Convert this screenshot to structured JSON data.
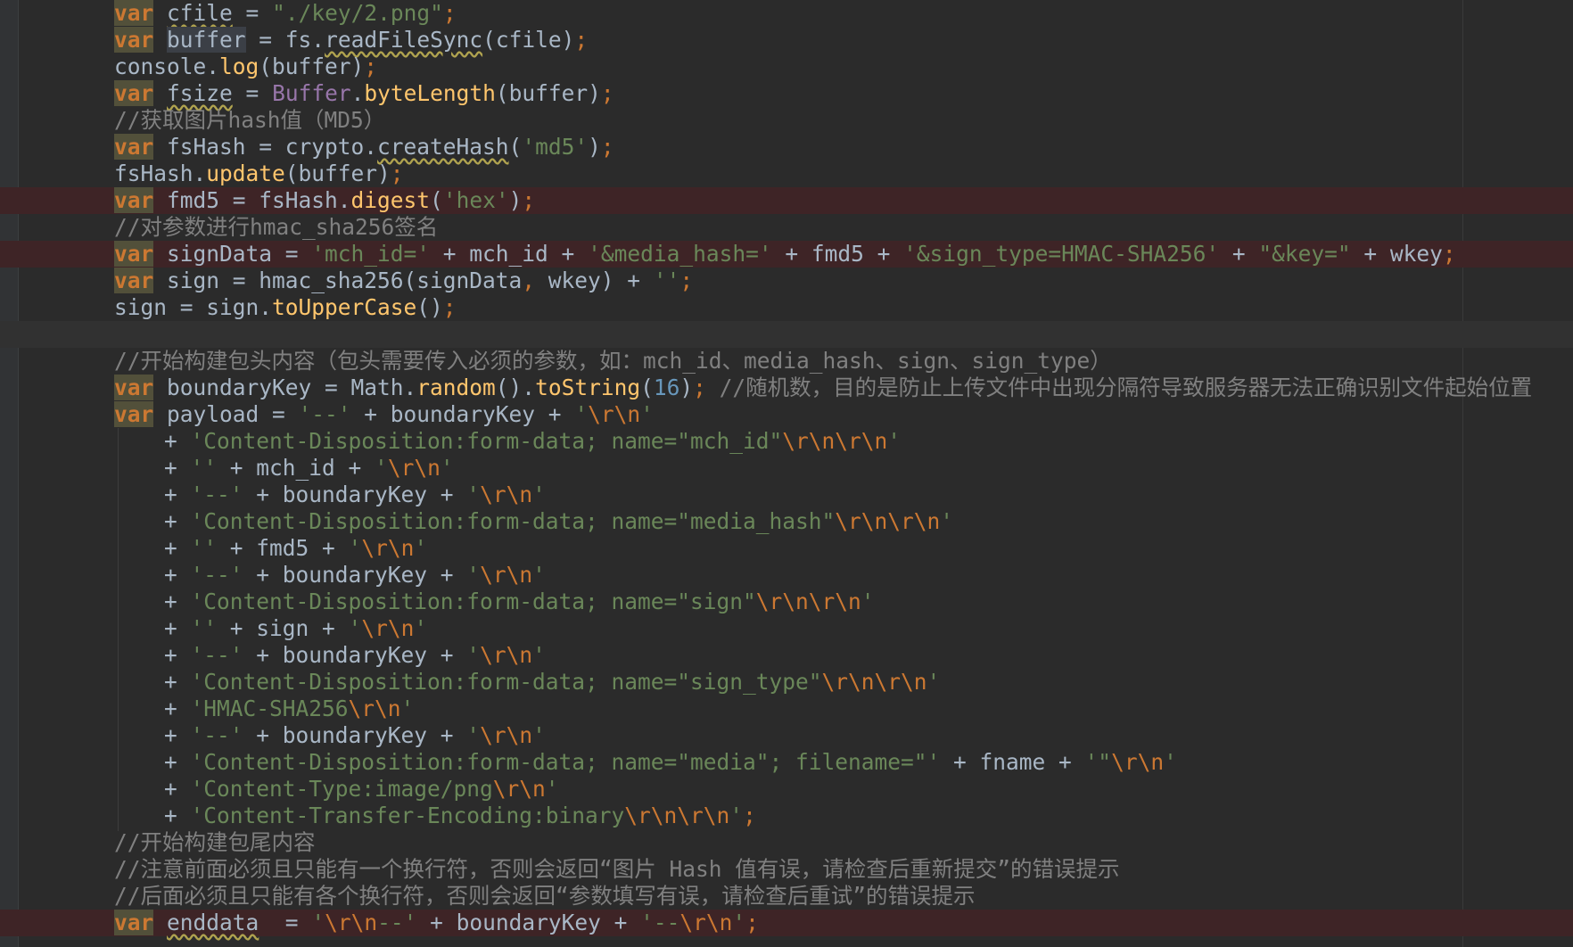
{
  "editor": {
    "lines": [
      {
        "type": "normal",
        "tokens": [
          [
            "kw",
            "var"
          ],
          [
            "t",
            " "
          ],
          [
            "sq",
            "cfile"
          ],
          [
            "t",
            " = "
          ],
          [
            "str",
            "\"./key/2.png\""
          ],
          [
            "pun",
            ";"
          ]
        ]
      },
      {
        "type": "normal",
        "tokens": [
          [
            "kw",
            "var"
          ],
          [
            "t",
            " "
          ],
          [
            "hl",
            "buffer"
          ],
          [
            "t",
            " = fs."
          ],
          [
            "sq",
            "readFileSync"
          ],
          [
            "t",
            "(cfile)"
          ],
          [
            "pun",
            ";"
          ]
        ]
      },
      {
        "type": "normal",
        "tokens": [
          [
            "t",
            "console."
          ],
          [
            "fn",
            "log"
          ],
          [
            "t",
            "(buffer)"
          ],
          [
            "pun",
            ";"
          ]
        ]
      },
      {
        "type": "normal",
        "tokens": [
          [
            "kw",
            "var"
          ],
          [
            "t",
            " "
          ],
          [
            "sq",
            "fsize"
          ],
          [
            "t",
            " = "
          ],
          [
            "cls",
            "Buffer"
          ],
          [
            "t",
            "."
          ],
          [
            "fn",
            "byteLength"
          ],
          [
            "t",
            "(buffer)"
          ],
          [
            "pun",
            ";"
          ]
        ]
      },
      {
        "type": "normal",
        "tokens": [
          [
            "cmt",
            "//获取图片hash值（MD5）"
          ]
        ]
      },
      {
        "type": "normal",
        "tokens": [
          [
            "kw",
            "var"
          ],
          [
            "t",
            " fsHash = crypto."
          ],
          [
            "sq",
            "createHash"
          ],
          [
            "t",
            "("
          ],
          [
            "str",
            "'md5'"
          ],
          [
            "t",
            ")"
          ],
          [
            "pun",
            ";"
          ]
        ]
      },
      {
        "type": "normal",
        "tokens": [
          [
            "t",
            "fsHash."
          ],
          [
            "fn",
            "update"
          ],
          [
            "t",
            "(buffer)"
          ],
          [
            "pun",
            ";"
          ]
        ]
      },
      {
        "type": "error",
        "tokens": [
          [
            "kw",
            "var"
          ],
          [
            "t",
            " fmd5 = fsHash."
          ],
          [
            "fn",
            "digest"
          ],
          [
            "t",
            "("
          ],
          [
            "str",
            "'hex'"
          ],
          [
            "t",
            ")"
          ],
          [
            "pun",
            ";"
          ]
        ]
      },
      {
        "type": "normal",
        "tokens": [
          [
            "cmt",
            "//对参数进行hmac_sha256签名"
          ]
        ]
      },
      {
        "type": "error",
        "tokens": [
          [
            "kw",
            "var"
          ],
          [
            "t",
            " signData = "
          ],
          [
            "str",
            "'mch_id='"
          ],
          [
            "t",
            " + mch_id + "
          ],
          [
            "str",
            "'&media_hash='"
          ],
          [
            "t",
            " + fmd5 + "
          ],
          [
            "str",
            "'&sign_type=HMAC-SHA256'"
          ],
          [
            "t",
            " + "
          ],
          [
            "str",
            "\"&key=\""
          ],
          [
            "t",
            " + wkey"
          ],
          [
            "pun",
            ";"
          ]
        ]
      },
      {
        "type": "normal",
        "tokens": [
          [
            "kw",
            "var"
          ],
          [
            "t",
            " sign = hmac_sha256(signData"
          ],
          [
            "pun",
            ","
          ],
          [
            "t",
            " wkey) + "
          ],
          [
            "str",
            "''"
          ],
          [
            "pun",
            ";"
          ]
        ]
      },
      {
        "type": "normal",
        "tokens": [
          [
            "t",
            "sign = sign."
          ],
          [
            "fn",
            "toUpperCase"
          ],
          [
            "t",
            "()"
          ],
          [
            "pun",
            ";"
          ]
        ]
      },
      {
        "type": "caret",
        "tokens": []
      },
      {
        "type": "normal",
        "tokens": [
          [
            "cmt",
            "//开始构建包头内容（包头需要传入必须的参数，如：mch_id、media_hash、sign、sign_type）"
          ]
        ]
      },
      {
        "type": "normal",
        "tokens": [
          [
            "kw",
            "var"
          ],
          [
            "t",
            " boundaryKey = Math."
          ],
          [
            "fn",
            "random"
          ],
          [
            "t",
            "()."
          ],
          [
            "fn",
            "toString"
          ],
          [
            "t",
            "("
          ],
          [
            "num",
            "16"
          ],
          [
            "t",
            ")"
          ],
          [
            "pun",
            ";"
          ],
          [
            "t",
            " "
          ],
          [
            "cmt",
            "//随机数，目的是防止上传文件中出现分隔符导致服务器无法正确识别文件起始位置"
          ]
        ]
      },
      {
        "type": "normal",
        "tokens": [
          [
            "kw",
            "var"
          ],
          [
            "t",
            " payload = "
          ],
          [
            "str",
            "'--'"
          ],
          [
            "t",
            " + boundaryKey + "
          ],
          [
            "str",
            "'"
          ],
          [
            "esc",
            "\\r\\n"
          ],
          [
            "str",
            "'"
          ]
        ]
      },
      {
        "type": "cont",
        "tokens": [
          [
            "t",
            "+ "
          ],
          [
            "str",
            "'Content-Disposition:form-data; name=\"mch_id\""
          ],
          [
            "esc",
            "\\r\\n\\r\\n"
          ],
          [
            "str",
            "'"
          ]
        ]
      },
      {
        "type": "cont",
        "tokens": [
          [
            "t",
            "+ "
          ],
          [
            "str",
            "''"
          ],
          [
            "t",
            " + mch_id + "
          ],
          [
            "str",
            "'"
          ],
          [
            "esc",
            "\\r\\n"
          ],
          [
            "str",
            "'"
          ]
        ]
      },
      {
        "type": "cont",
        "tokens": [
          [
            "t",
            "+ "
          ],
          [
            "str",
            "'--'"
          ],
          [
            "t",
            " + boundaryKey + "
          ],
          [
            "str",
            "'"
          ],
          [
            "esc",
            "\\r\\n"
          ],
          [
            "str",
            "'"
          ]
        ]
      },
      {
        "type": "cont",
        "tokens": [
          [
            "t",
            "+ "
          ],
          [
            "str",
            "'Content-Disposition:form-data; name=\"media_hash\""
          ],
          [
            "esc",
            "\\r\\n\\r\\n"
          ],
          [
            "str",
            "'"
          ]
        ]
      },
      {
        "type": "cont",
        "tokens": [
          [
            "t",
            "+ "
          ],
          [
            "str",
            "''"
          ],
          [
            "t",
            " + fmd5 + "
          ],
          [
            "str",
            "'"
          ],
          [
            "esc",
            "\\r\\n"
          ],
          [
            "str",
            "'"
          ]
        ]
      },
      {
        "type": "cont",
        "tokens": [
          [
            "t",
            "+ "
          ],
          [
            "str",
            "'--'"
          ],
          [
            "t",
            " + boundaryKey + "
          ],
          [
            "str",
            "'"
          ],
          [
            "esc",
            "\\r\\n"
          ],
          [
            "str",
            "'"
          ]
        ]
      },
      {
        "type": "cont",
        "tokens": [
          [
            "t",
            "+ "
          ],
          [
            "str",
            "'Content-Disposition:form-data; name=\"sign\""
          ],
          [
            "esc",
            "\\r\\n\\r\\n"
          ],
          [
            "str",
            "'"
          ]
        ]
      },
      {
        "type": "cont",
        "tokens": [
          [
            "t",
            "+ "
          ],
          [
            "str",
            "''"
          ],
          [
            "t",
            " + sign + "
          ],
          [
            "str",
            "'"
          ],
          [
            "esc",
            "\\r\\n"
          ],
          [
            "str",
            "'"
          ]
        ]
      },
      {
        "type": "cont",
        "tokens": [
          [
            "t",
            "+ "
          ],
          [
            "str",
            "'--'"
          ],
          [
            "t",
            " + boundaryKey + "
          ],
          [
            "str",
            "'"
          ],
          [
            "esc",
            "\\r\\n"
          ],
          [
            "str",
            "'"
          ]
        ]
      },
      {
        "type": "cont",
        "tokens": [
          [
            "t",
            "+ "
          ],
          [
            "str",
            "'Content-Disposition:form-data; name=\"sign_type\""
          ],
          [
            "esc",
            "\\r\\n\\r\\n"
          ],
          [
            "str",
            "'"
          ]
        ]
      },
      {
        "type": "cont",
        "tokens": [
          [
            "t",
            "+ "
          ],
          [
            "str",
            "'HMAC-SHA256"
          ],
          [
            "esc",
            "\\r\\n"
          ],
          [
            "str",
            "'"
          ]
        ]
      },
      {
        "type": "cont",
        "tokens": [
          [
            "t",
            "+ "
          ],
          [
            "str",
            "'--'"
          ],
          [
            "t",
            " + boundaryKey + "
          ],
          [
            "str",
            "'"
          ],
          [
            "esc",
            "\\r\\n"
          ],
          [
            "str",
            "'"
          ]
        ]
      },
      {
        "type": "cont",
        "tokens": [
          [
            "t",
            "+ "
          ],
          [
            "str",
            "'Content-Disposition:form-data; name=\"media\"; filename=\"'"
          ],
          [
            "t",
            " + fname + "
          ],
          [
            "str",
            "'\""
          ],
          [
            "esc",
            "\\r\\n"
          ],
          [
            "str",
            "'"
          ]
        ]
      },
      {
        "type": "cont",
        "tokens": [
          [
            "t",
            "+ "
          ],
          [
            "str",
            "'Content-Type:image/png"
          ],
          [
            "esc",
            "\\r\\n"
          ],
          [
            "str",
            "'"
          ]
        ]
      },
      {
        "type": "cont",
        "tokens": [
          [
            "t",
            "+ "
          ],
          [
            "str",
            "'Content-Transfer-Encoding:binary"
          ],
          [
            "esc",
            "\\r\\n\\r\\n"
          ],
          [
            "str",
            "'"
          ],
          [
            "pun",
            ";"
          ]
        ]
      },
      {
        "type": "normal",
        "tokens": [
          [
            "cmt",
            "//开始构建包尾内容"
          ]
        ]
      },
      {
        "type": "normal",
        "tokens": [
          [
            "cmt",
            "//注意前面必须且只能有一个换行符，否则会返回“图片 Hash 值有误，请检查后重新提交”的错误提示"
          ]
        ]
      },
      {
        "type": "normal",
        "tokens": [
          [
            "cmt",
            "//后面必须且只能有各个换行符，否则会返回“参数填写有误，请检查后重试”的错误提示"
          ]
        ]
      },
      {
        "type": "error",
        "tokens": [
          [
            "kw",
            "var"
          ],
          [
            "t",
            " "
          ],
          [
            "sq",
            "enddata"
          ],
          [
            "t",
            "  = "
          ],
          [
            "str",
            "'"
          ],
          [
            "esc",
            "\\r\\n"
          ],
          [
            "str",
            "--'"
          ],
          [
            "t",
            " + boundaryKey + "
          ],
          [
            "str",
            "'--"
          ],
          [
            "esc",
            "\\r\\n"
          ],
          [
            "str",
            "'"
          ],
          [
            "pun",
            ";"
          ]
        ]
      }
    ]
  }
}
